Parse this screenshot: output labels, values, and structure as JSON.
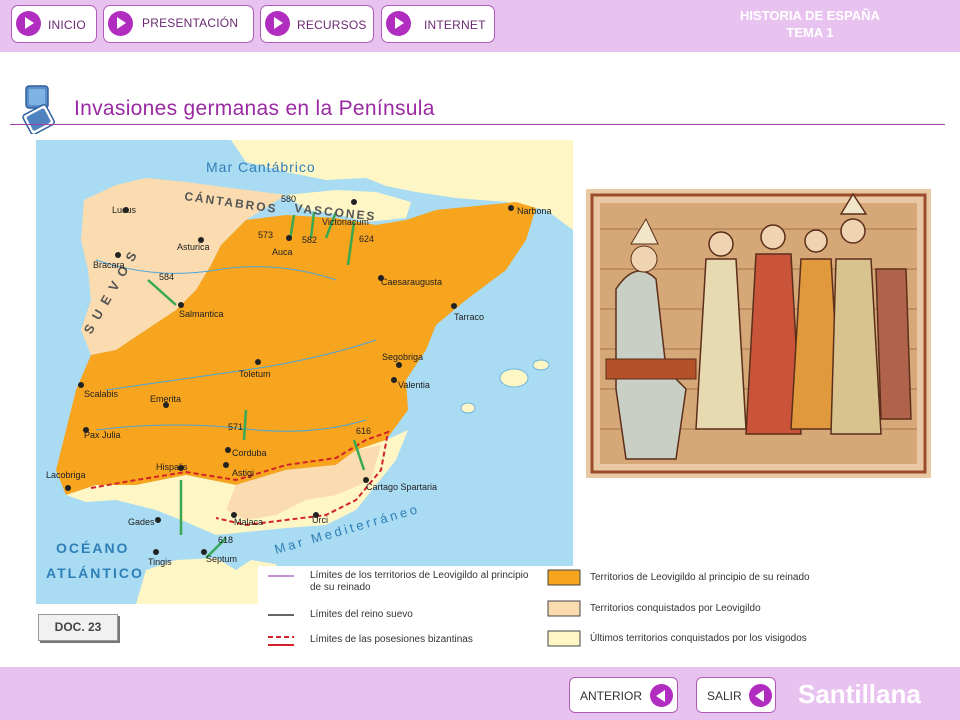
{
  "nav": {
    "inicio": "INICIO",
    "presentacion": "PRESENTACIÓN",
    "recursos": "RECURSOS",
    "internet": "INTERNET"
  },
  "course": {
    "subject": "HISTORIA DE ESPAÑA",
    "unit": "TEMA 1"
  },
  "page_title": "Invasiones germanas en la Península",
  "map": {
    "seas": [
      "Mar Cantábrico",
      "OCÉANO",
      "ATLÁNTICO",
      "Mar Mediterráneo"
    ],
    "peoples": [
      "CÁNTABROS",
      "VASCONES",
      "S U E V O S"
    ],
    "cities": [
      "Lucus",
      "Asturica",
      "Bracara",
      "Auca",
      "Victoriacum",
      "Narbona",
      "Caesaraugusta",
      "Salmantica",
      "Tarraco",
      "Segobriga",
      "Toletum",
      "Valentia",
      "Scalabis",
      "Emerita",
      "Pax Julia",
      "Corduba",
      "Hispalis",
      "Astigi",
      "Lacobriga",
      "Gades",
      "Malaca",
      "Urci",
      "Cartago Spartaria",
      "Tingis",
      "Septum"
    ],
    "years": [
      "580",
      "573",
      "582",
      "624",
      "584",
      "571",
      "616",
      "618"
    ]
  },
  "legend": {
    "limits_start": "Límites de los territorios de Leovigildo al principio de su reinado",
    "limits_suevo": "Límites del reino suevo",
    "limits_byz": "Límites de las posesiones bizantinas",
    "terr_start": "Territorios de Leovigildo al principio de su reinado",
    "terr_conq": "Territorios conquistados por Leovigildo",
    "terr_last": "Últimos territorios conquistados por los visigodos"
  },
  "doc_label": "DOC. 23",
  "footer": {
    "anterior": "ANTERIOR",
    "salir": "SALIR",
    "brand": "Santillana"
  },
  "colors": {
    "bar": "#e9c3ef",
    "accent": "#b02dbf",
    "orange": "#f7a41e",
    "beige": "#fbdcb0",
    "cream": "#fff6c6",
    "sea": "#a9dbf2"
  }
}
